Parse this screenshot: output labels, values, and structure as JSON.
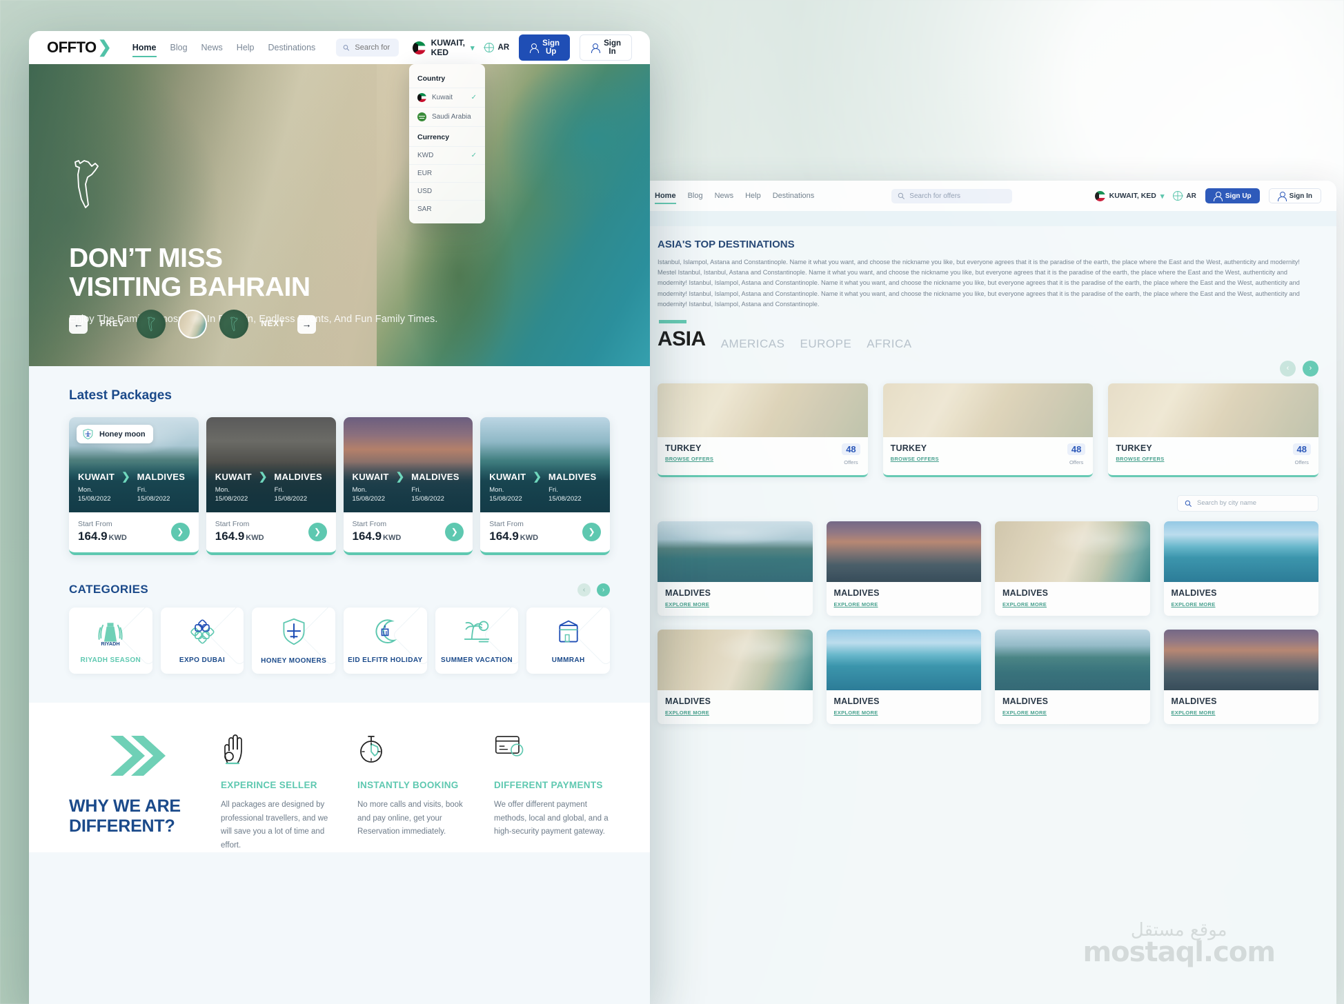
{
  "brand": {
    "name": "OFFTO",
    "accent": "#52c2a8",
    "blue": "#1f4eb5",
    "navy": "#1b4a8a"
  },
  "window1": {
    "nav": {
      "links": [
        {
          "label": "Home",
          "active": true
        },
        {
          "label": "Blog",
          "active": false
        },
        {
          "label": "News",
          "active": false
        },
        {
          "label": "Help",
          "active": false
        },
        {
          "label": "Destinations",
          "active": false
        }
      ],
      "search_placeholder": "Search for offers",
      "search_value": "",
      "country_label": "KUWAIT, KED",
      "lang_label": "AR",
      "signup_label": "Sign Up",
      "signin_label": "Sign In"
    },
    "dropdown": {
      "country_heading": "Country",
      "countries": [
        {
          "label": "Kuwait",
          "selected": true
        },
        {
          "label": "Saudi Arabia",
          "selected": false
        }
      ],
      "currency_heading": "Currency",
      "currencies": [
        {
          "label": "KWD",
          "selected": true
        },
        {
          "label": "EUR",
          "selected": false
        },
        {
          "label": "USD",
          "selected": false
        },
        {
          "label": "SAR",
          "selected": false
        }
      ]
    },
    "hero": {
      "title_line1": "DON’T MISS",
      "title_line2": "VISITING BAHRAIN",
      "subtitle": "Enjoy The Family Atmosphere In Bahrain, Endless Events, And Fun Family Times.",
      "prev_label": "PREV",
      "next_label": "NEXT"
    },
    "packages": {
      "title": "Latest Packages",
      "items": [
        {
          "badge": "Honey moon",
          "from_city": "KUWAIT",
          "to_city": "MALDIVES",
          "depart_day": "Mon.",
          "depart_date": "15/08/2022",
          "return_day": "Fri.",
          "return_date": "15/08/2022",
          "price_label": "Start From",
          "price": "164.9",
          "currency": "KWD"
        },
        {
          "badge": "",
          "from_city": "KUWAIT",
          "to_city": "MALDIVES",
          "depart_day": "Mon.",
          "depart_date": "15/08/2022",
          "return_day": "Fri.",
          "return_date": "15/08/2022",
          "price_label": "Start From",
          "price": "164.9",
          "currency": "KWD"
        },
        {
          "badge": "",
          "from_city": "KUWAIT",
          "to_city": "MALDIVES",
          "depart_day": "Mon.",
          "depart_date": "15/08/2022",
          "return_day": "Fri.",
          "return_date": "15/08/2022",
          "price_label": "Start From",
          "price": "164.9",
          "currency": "KWD"
        },
        {
          "badge": "",
          "from_city": "KUWAIT",
          "to_city": "MALDIVES",
          "depart_day": "Mon.",
          "depart_date": "15/08/2022",
          "return_day": "Fri.",
          "return_date": "15/08/2022",
          "price_label": "Start From",
          "price": "164.9",
          "currency": "KWD"
        }
      ]
    },
    "categories": {
      "title": "CATEGORIES",
      "items": [
        {
          "label": "RIYADH SEASON",
          "icon": "riyadh-icon",
          "green": true
        },
        {
          "label": "EXPO DUBAI",
          "icon": "rosette-icon",
          "green": false
        },
        {
          "label": "HONEY MOONERS",
          "icon": "plane-shield-icon",
          "green": false
        },
        {
          "label": "EID ELFITR HOLIDAY",
          "icon": "crescent-mosque-icon",
          "green": false
        },
        {
          "label": "SUMMER VACATION",
          "icon": "palm-sun-icon",
          "green": false
        },
        {
          "label": "UMMRAH",
          "icon": "kaaba-icon",
          "green": false
        }
      ]
    },
    "why": {
      "heading_line1": "WHY WE ARE",
      "heading_line2": "DIFFERENT?",
      "features": [
        {
          "icon": "ok-hand-icon",
          "title": "EXPERINCE SELLER",
          "text": "All packages are designed by professional travellers, and we will save you a lot of time and effort."
        },
        {
          "icon": "stopwatch-icon",
          "title": "INSTANTLY BOOKING",
          "text": "No more calls and visits, book and pay online, get your Reservation immediately."
        },
        {
          "icon": "credit-card-icon",
          "title": "DIFFERENT PAYMENTS",
          "text": "We offer different payment methods, local and global, and a high-security payment gateway."
        }
      ]
    }
  },
  "window2": {
    "nav": {
      "links": [
        {
          "label": "Home",
          "active": true
        },
        {
          "label": "Blog",
          "active": false
        },
        {
          "label": "News",
          "active": false
        },
        {
          "label": "Help",
          "active": false
        },
        {
          "label": "Destinations",
          "active": false
        }
      ],
      "search_placeholder": "Search for offers",
      "country_label": "KUWAIT, KED",
      "lang_label": "AR",
      "signup_label": "Sign Up",
      "signin_label": "Sign In"
    },
    "article": {
      "heading": "ASIA'S TOP DESTINATIONS",
      "paragraphs": [
        "Istanbul, Islampol, Astana and Constantinople. Name it what you want, and choose the nickname you like, but everyone agrees that it is the paradise of the earth, the place where the East and the West, authenticity and modernity! Mestel Istanbul, Istanbul, Astana and Constantinople. Name it what you want, and choose the nickname you like, but everyone agrees that it is the paradise of the earth, the place where the East and the West, authenticity and modernity! Istanbul, Islampol, Astana and Constantinople. Name it what you want, and choose the nickname you like, but everyone agrees that it is the paradise of the earth, the place where the East and the West, authenticity and modernity! Istanbul, Islampol, Astana and Constantinople. Name it what you want, and choose the nickname you like, but everyone agrees that it is the paradise of the earth, the place where the East and the West, authenticity and modernity! Istanbul, Islampol, Astana and Constantinople."
      ]
    },
    "regions": {
      "current": "ASIA",
      "others": [
        "AMERICAS",
        "EUROPE",
        "AFRICA"
      ]
    },
    "offer_cards": [
      {
        "title": "TURKEY",
        "link": "BROWSE OFFERS",
        "count": "48",
        "count_label": "Offers"
      },
      {
        "title": "TURKEY",
        "link": "BROWSE OFFERS",
        "count": "48",
        "count_label": "Offers"
      },
      {
        "title": "TURKEY",
        "link": "BROWSE OFFERS",
        "count": "48",
        "count_label": "Offers"
      }
    ],
    "city_search_placeholder": "Search by city name",
    "tiles": [
      {
        "title": "MALDIVES",
        "link": "EXPLORE MORE"
      },
      {
        "title": "MALDIVES",
        "link": "EXPLORE MORE"
      },
      {
        "title": "MALDIVES",
        "link": "EXPLORE MORE"
      },
      {
        "title": "MALDIVES",
        "link": "EXPLORE MORE"
      },
      {
        "title": "MALDIVES",
        "link": "EXPLORE MORE"
      },
      {
        "title": "MALDIVES",
        "link": "EXPLORE MORE"
      },
      {
        "title": "MALDIVES",
        "link": "EXPLORE MORE"
      },
      {
        "title": "MALDIVES",
        "link": "EXPLORE MORE"
      }
    ]
  },
  "watermark": {
    "arabic": "موقع مستقل",
    "latin": "mostaql.com"
  }
}
